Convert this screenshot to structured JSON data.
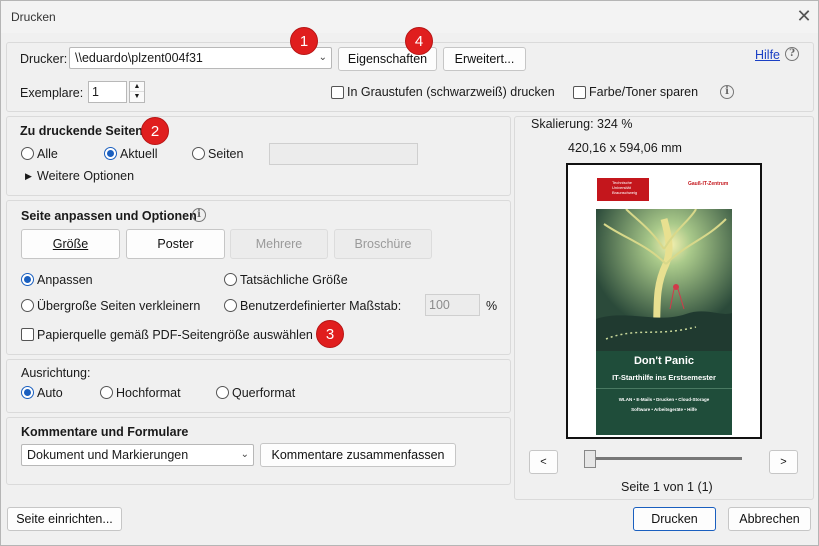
{
  "window": {
    "title": "Drucken"
  },
  "printer": {
    "label": "Drucker:",
    "selected": "\\\\eduardo\\plzent004f31",
    "properties_button": "Eigenschaften",
    "advanced_button": "Erweitert...",
    "help_link": "Hilfe",
    "copies_label": "Exemplare:",
    "copies_value": "1",
    "grayscale_label": "In Graustufen (schwarzweiß) drucken",
    "save_toner_label": "Farbe/Toner sparen"
  },
  "pages_to_print": {
    "heading": "Zu druckende Seiten",
    "options": [
      "Alle",
      "Aktuell",
      "Seiten"
    ],
    "selected": "Aktuell",
    "pages_value": "",
    "more_options": "Weitere Optionen"
  },
  "page_sizing": {
    "heading": "Seite anpassen und Optionen",
    "tabs": [
      "Größe",
      "Poster",
      "Mehrere",
      "Broschüre"
    ],
    "fit_label": "Anpassen",
    "actual_size_label": "Tatsächliche Größe",
    "shrink_label": "Übergroße Seiten verkleinern",
    "custom_scale_label": "Benutzerdefinierter Maßstab:",
    "custom_scale_value": "100",
    "custom_scale_unit": "%",
    "paper_source_label": "Papierquelle gemäß PDF-Seitengröße auswählen"
  },
  "orientation": {
    "heading": "Ausrichtung:",
    "options": [
      "Auto",
      "Hochformat",
      "Querformat"
    ],
    "selected": "Auto"
  },
  "comments": {
    "heading": "Kommentare und Formulare",
    "selected": "Dokument und Markierungen",
    "summarize_button": "Kommentare zusammenfassen"
  },
  "preview": {
    "scaling": "Skalierung: 324 %",
    "dimensions": "420,16 x 594,06 mm",
    "prev_button": "<",
    "next_button": ">",
    "page_status": "Seite 1 von 1 (1)",
    "doc_logo_text": [
      "Technische",
      "Universität",
      "Braunschweig"
    ],
    "doc_header_right": "Gauß-IT-Zentrum",
    "doc_title": "Don't Panic",
    "doc_subtitle": "IT-Starthilfe ins Erstsemester",
    "doc_line1": "WLAN • E-Mails • Drucken • Cloud-Storage",
    "doc_line2": "Software • Arbeitsgeräte • Hilfe"
  },
  "footer": {
    "page_setup_button": "Seite einrichten...",
    "print_button": "Drucken",
    "cancel_button": "Abbrechen"
  },
  "badges": [
    "1",
    "2",
    "3",
    "4"
  ],
  "colors": {
    "badge": "#e01e1e",
    "radio_accent": "#1a5fbf",
    "doc_red": "#c4161c",
    "doc_green": "#1f4d3a"
  }
}
